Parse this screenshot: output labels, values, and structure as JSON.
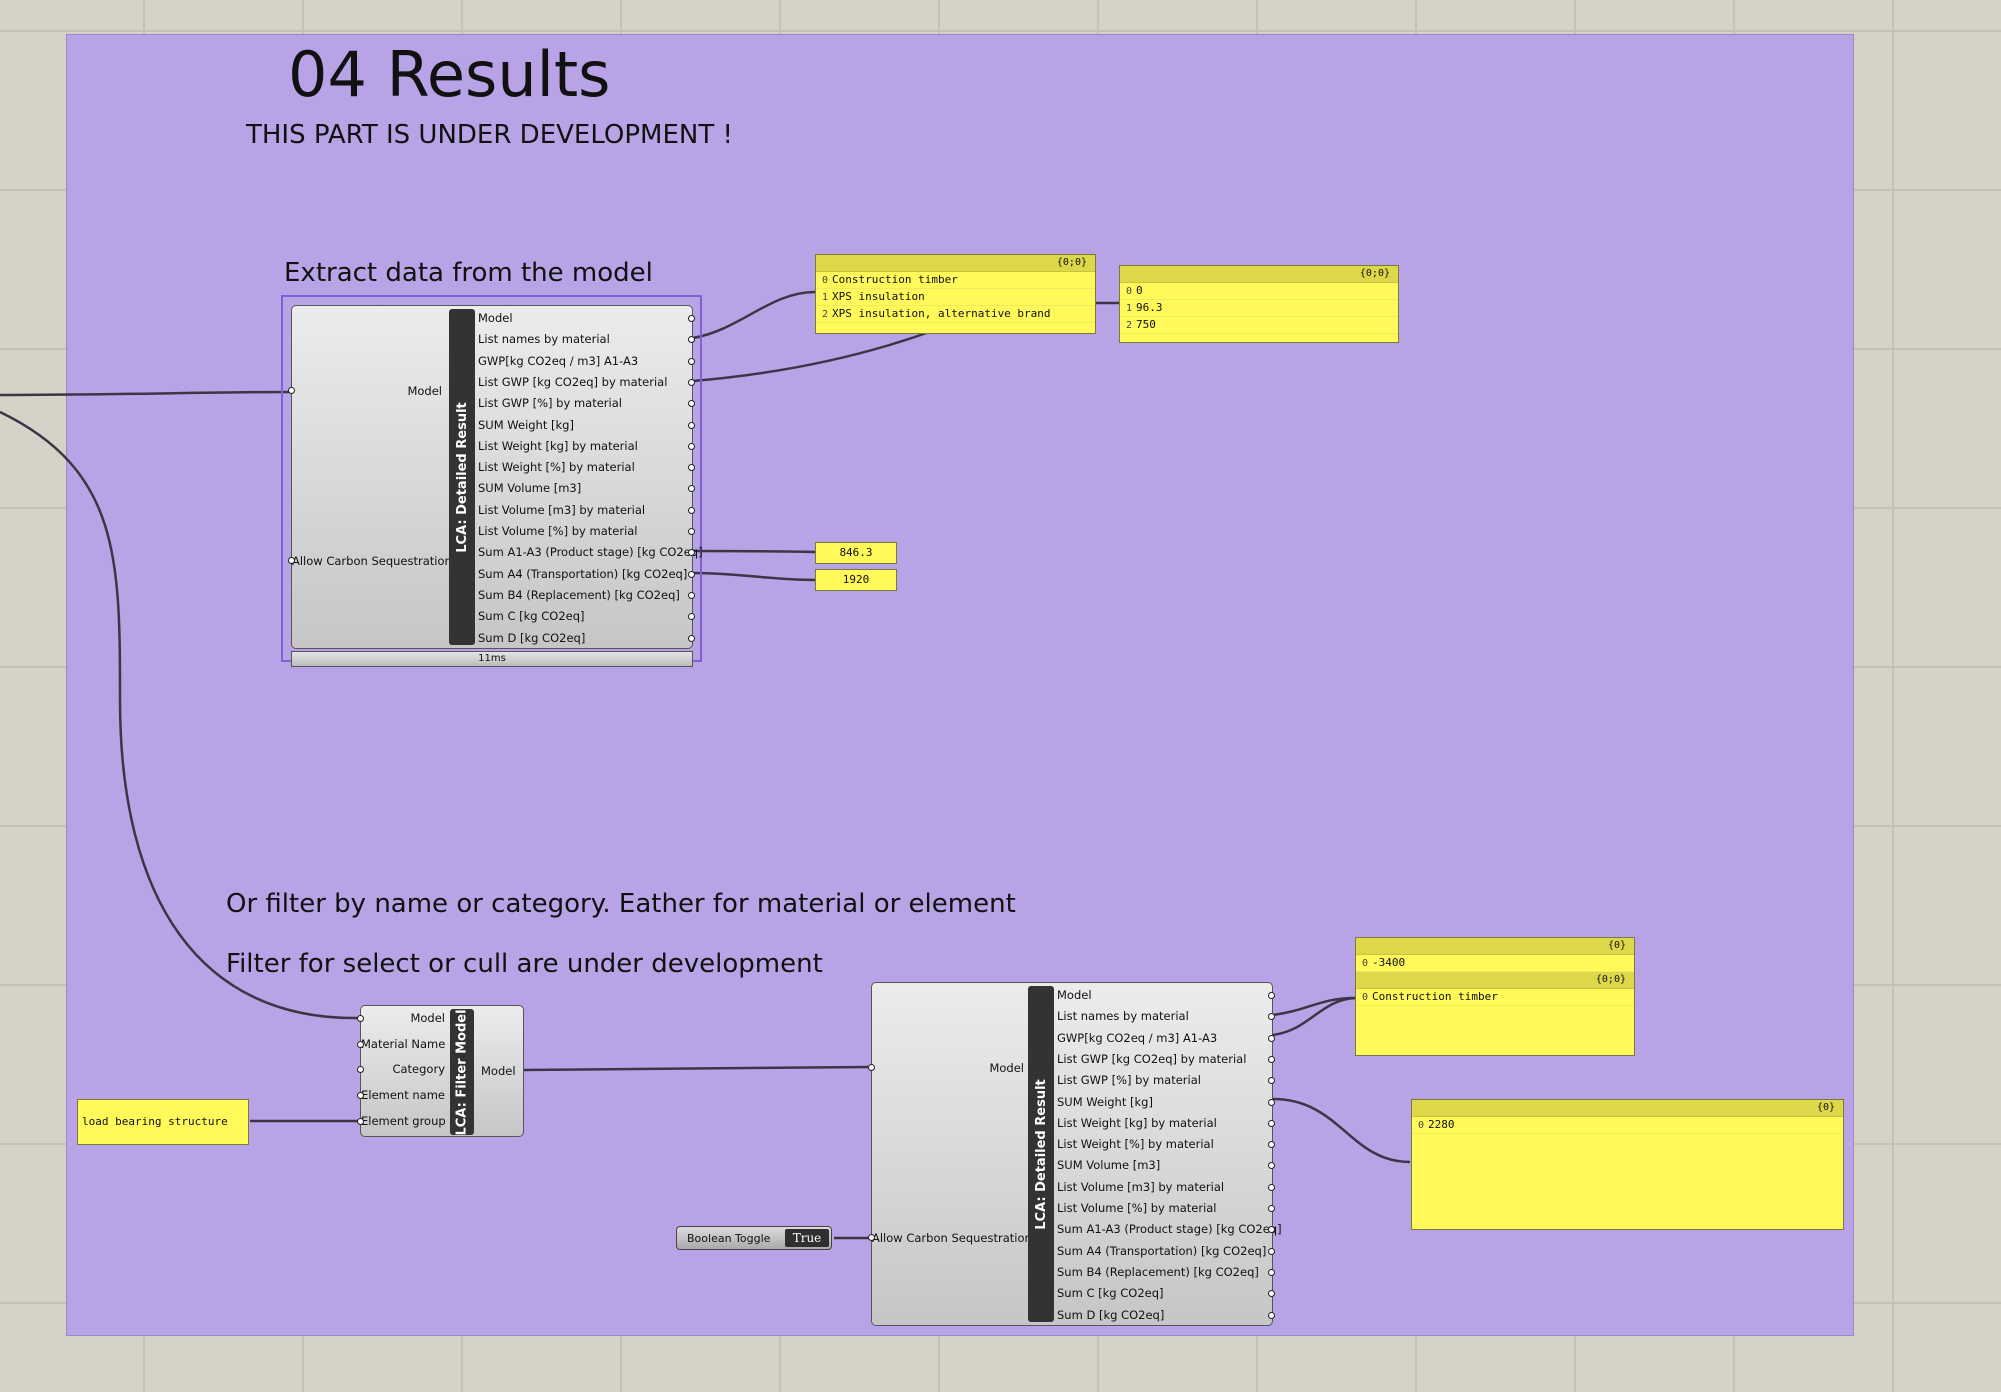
{
  "header": {
    "title": "04 Results",
    "subtitle": "THIS PART IS UNDER DEVELOPMENT !"
  },
  "section1": {
    "heading": "Extract data from the model"
  },
  "section2": {
    "heading1": "Or filter by name or category. Eather for material or element",
    "heading2": "Filter for select or cull are under development"
  },
  "detailed_result_1": {
    "name": "LCA: Detailed Result",
    "inputs": [
      "Model",
      "Allow Carbon Sequestration"
    ],
    "outputs": [
      "Model",
      "List names by material",
      "GWP[kg CO2eq / m3] A1-A3",
      "List GWP [kg CO2eq] by material",
      "List GWP [%] by material",
      "SUM Weight [kg]",
      "List Weight [kg] by material",
      "List Weight [%] by material",
      "SUM Volume [m3]",
      "List Volume [m3] by material",
      "List Volume [%] by material",
      "Sum A1-A3 (Product stage) [kg CO2eq]",
      "Sum A4 (Transportation) [kg CO2eq]",
      "Sum B4 (Replacement) [kg CO2eq]",
      "Sum C [kg CO2eq]",
      "Sum D [kg CO2eq]"
    ],
    "timer": "11ms"
  },
  "detailed_result_2": {
    "name": "LCA: Detailed Result",
    "inputs": [
      "Model",
      "Allow Carbon Sequestration"
    ],
    "outputs": [
      "Model",
      "List names by material",
      "GWP[kg CO2eq / m3] A1-A3",
      "List GWP [kg CO2eq] by material",
      "List GWP [%] by material",
      "SUM Weight [kg]",
      "List Weight [kg] by material",
      "List Weight [%] by material",
      "SUM Volume [m3]",
      "List Volume [m3] by material",
      "List Volume [%] by material",
      "Sum A1-A3 (Product stage) [kg CO2eq]",
      "Sum A4 (Transportation) [kg CO2eq]",
      "Sum B4 (Replacement) [kg CO2eq]",
      "Sum C [kg CO2eq]",
      "Sum D [kg CO2eq]"
    ]
  },
  "filter_model": {
    "name": "LCA: Filter Model",
    "inputs": [
      "Model",
      "Material Name",
      "Category",
      "Element name",
      "Element group"
    ],
    "output": "Model"
  },
  "panel_names": {
    "path": "{0;0}",
    "items": [
      {
        "i": "0",
        "v": "Construction timber"
      },
      {
        "i": "1",
        "v": "XPS insulation"
      },
      {
        "i": "2",
        "v": "XPS insulation, alternative brand"
      }
    ]
  },
  "panel_gwp": {
    "path": "{0;0}",
    "items": [
      {
        "i": "0",
        "v": "0"
      },
      {
        "i": "1",
        "v": "96.3"
      },
      {
        "i": "2",
        "v": "750"
      }
    ]
  },
  "value_a1a3": "846.3",
  "value_a4": "1920",
  "panel_b1": {
    "path": "{0}",
    "items": [
      {
        "i": "0",
        "v": "-3400"
      }
    ]
  },
  "panel_b2": {
    "path": "{0;0}",
    "items": [
      {
        "i": "0",
        "v": "Construction timber"
      }
    ]
  },
  "panel_weight": {
    "path": "{0}",
    "items": [
      {
        "i": "0",
        "v": "2280"
      }
    ]
  },
  "input_panel": "load bearing structure",
  "boolean_toggle": {
    "label": "Boolean Toggle",
    "value": "True"
  },
  "colors": {
    "group": "#b8a3e6",
    "panel": "#fff95a",
    "canvas": "#d5d2c8"
  }
}
